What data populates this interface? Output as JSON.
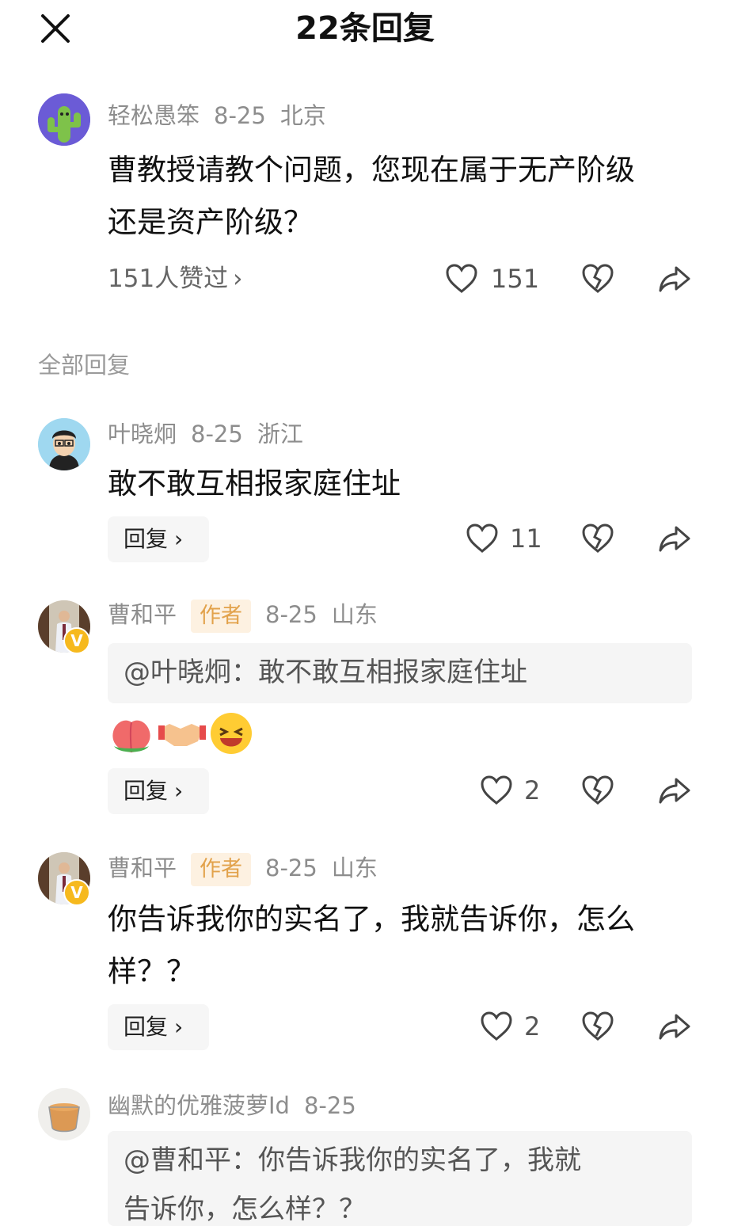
{
  "header": {
    "title": "22条回复"
  },
  "main_comment": {
    "user": "轻松愚笨",
    "date": "8-25",
    "location": "北京",
    "text_line1": "曹教授请教个问题，您现在属于无产阶级",
    "text_line2": "还是资产阶级？",
    "likes_link": "151人赞过",
    "like_count": "151"
  },
  "section_label": "全部回复",
  "replies": [
    {
      "user": "叶晓炯",
      "date": "8-25",
      "location": "浙江",
      "text": "敢不敢互相报家庭住址",
      "reply_label": "回复",
      "like_count": "11"
    },
    {
      "user": "曹和平",
      "badge": "作者",
      "date": "8-25",
      "location": "山东",
      "quote": "@叶晓炯：敢不敢互相报家庭住址",
      "emojis": [
        "peach-emoji",
        "handshake-emoji",
        "laughing-emoji"
      ],
      "reply_label": "回复",
      "like_count": "2"
    },
    {
      "user": "曹和平",
      "badge": "作者",
      "date": "8-25",
      "location": "山东",
      "text_line1": "你告诉我你的实名了，我就告诉你，怎么",
      "text_line2": "样？？",
      "reply_label": "回复",
      "like_count": "2"
    },
    {
      "user": "幽默的优雅菠萝Id",
      "date": "8-25",
      "quote_line1": "@曹和平：你告诉我你的实名了，我就",
      "quote_line2": "告诉你，怎么样？？"
    }
  ],
  "colors": {
    "meta_gray": "#8d8d8d",
    "badge_bg": "#fdf1e1",
    "badge_text": "#e2a24b",
    "reply_bg": "#f6f6f6"
  }
}
